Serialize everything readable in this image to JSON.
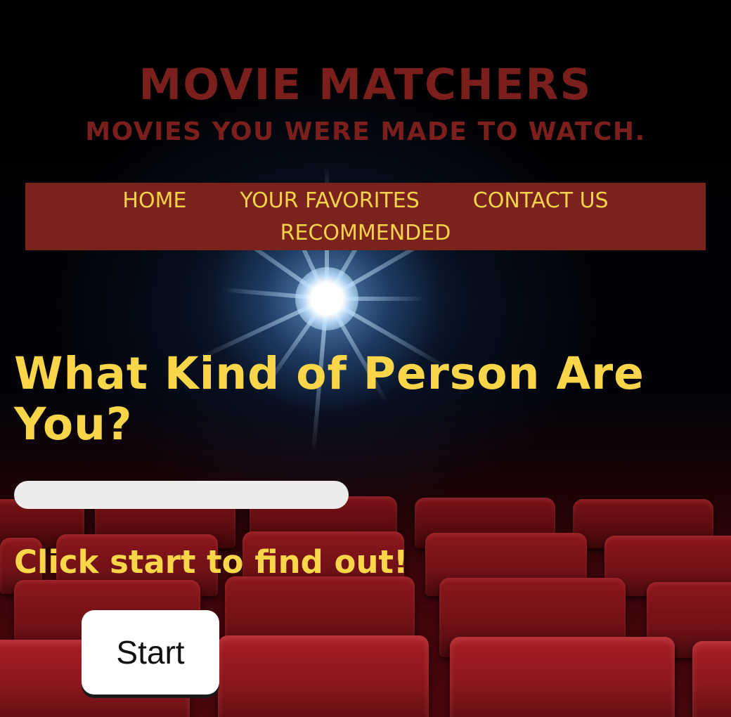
{
  "header": {
    "title": "MOVIE MATCHERS",
    "tagline": "MOVIES YOU WERE MADE TO WATCH."
  },
  "nav": {
    "items": [
      {
        "label": "HOME"
      },
      {
        "label": "YOUR FAVORITES"
      },
      {
        "label": "CONTACT US"
      },
      {
        "label": "RECOMMENDED"
      }
    ]
  },
  "quiz": {
    "heading": "What Kind of Person Are You?",
    "progress": 0,
    "prompt": "Click start to find out!",
    "start_label": "Start"
  },
  "colors": {
    "header_text": "#7a1f1b",
    "nav_background": "#7a221c",
    "accent_yellow": "#f9d54a",
    "progress_track": "#ececec",
    "button_background": "#ffffff"
  },
  "background": {
    "image": "theater-projector-icon"
  }
}
